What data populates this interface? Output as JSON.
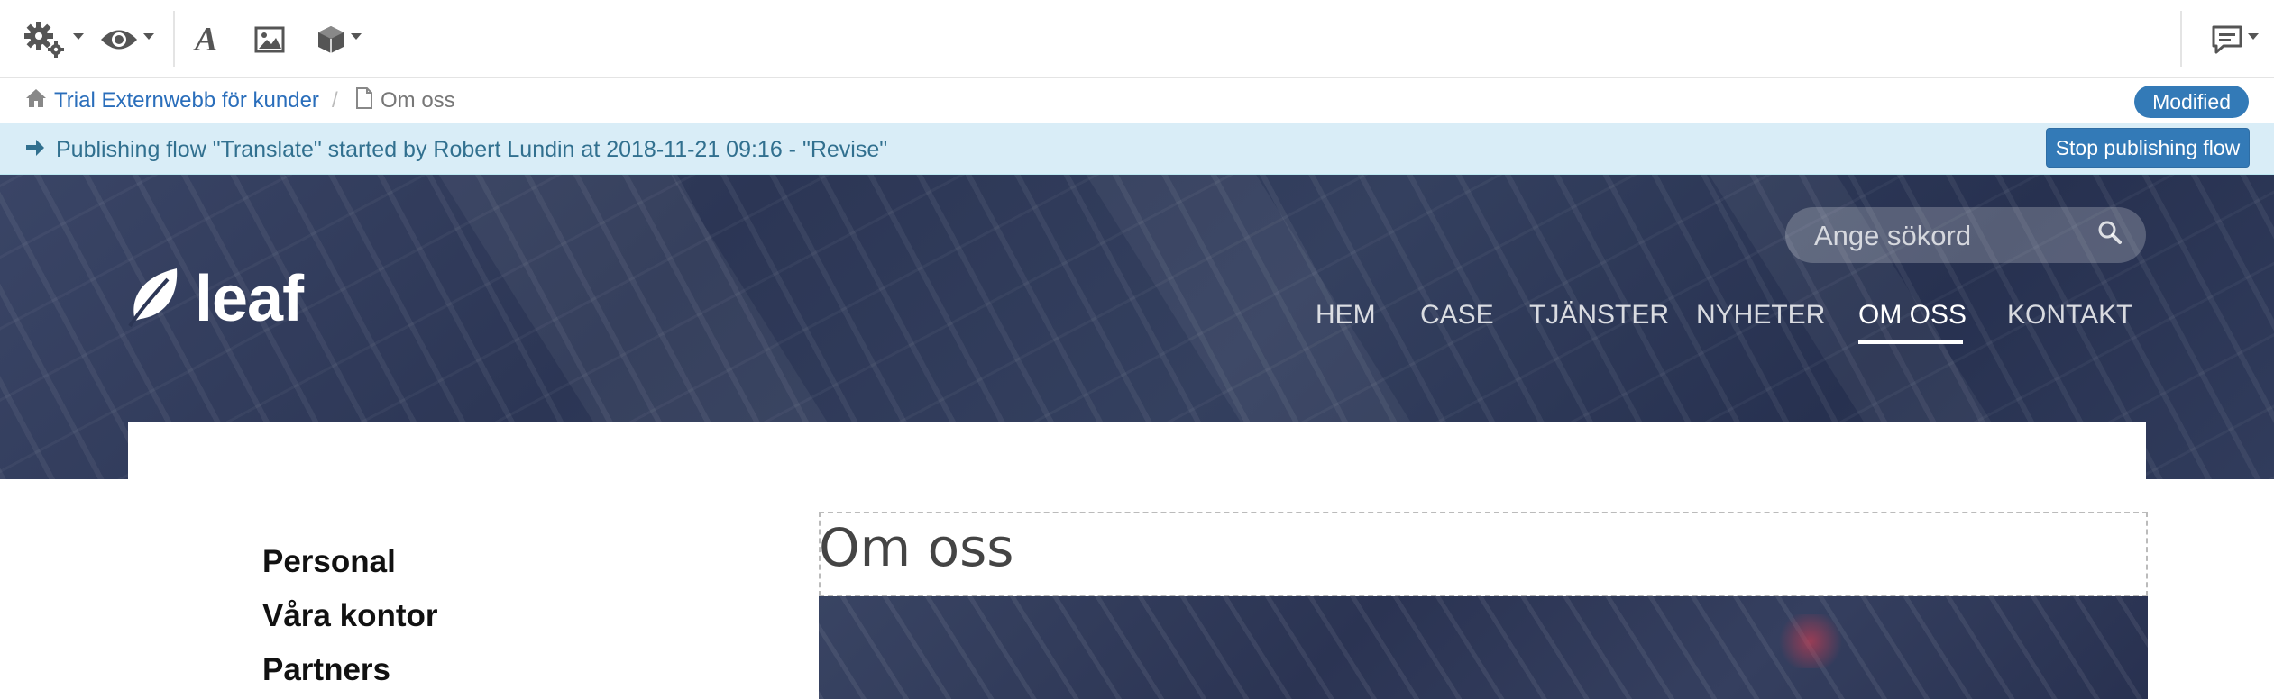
{
  "breadcrumb": {
    "home_label": "Trial Externwebb för kunder",
    "separator": "/",
    "current_label": "Om oss"
  },
  "status_badge": "Modified",
  "alert": {
    "message": "Publishing flow \"Translate\" started by Robert Lundin at 2018-11-21 09:16 - \"Revise\"",
    "stop_button": "Stop publishing flow"
  },
  "site": {
    "logo_text": "leaf",
    "search_placeholder": "Ange sökord",
    "nav": [
      {
        "label": "HEM",
        "active": false
      },
      {
        "label": "CASE",
        "active": false
      },
      {
        "label": "TJÄNSTER",
        "active": false
      },
      {
        "label": "NYHETER",
        "active": false
      },
      {
        "label": "OM OSS",
        "active": true
      },
      {
        "label": "KONTAKT",
        "active": false
      }
    ]
  },
  "sidebar": {
    "links": [
      "Personal",
      "Våra kontor",
      "Partners"
    ]
  },
  "page": {
    "title": "Om oss"
  },
  "icons": {
    "settings": "gears-icon",
    "preview": "eye-icon",
    "text": "font-icon",
    "image": "image-icon",
    "components": "cube-icon",
    "comments": "comments-icon"
  },
  "colors": {
    "primary": "#337ab7",
    "link": "#2a6ebb",
    "alert_bg": "#d9edf7",
    "alert_text": "#31708f",
    "hero_bg": "#2c3655"
  }
}
